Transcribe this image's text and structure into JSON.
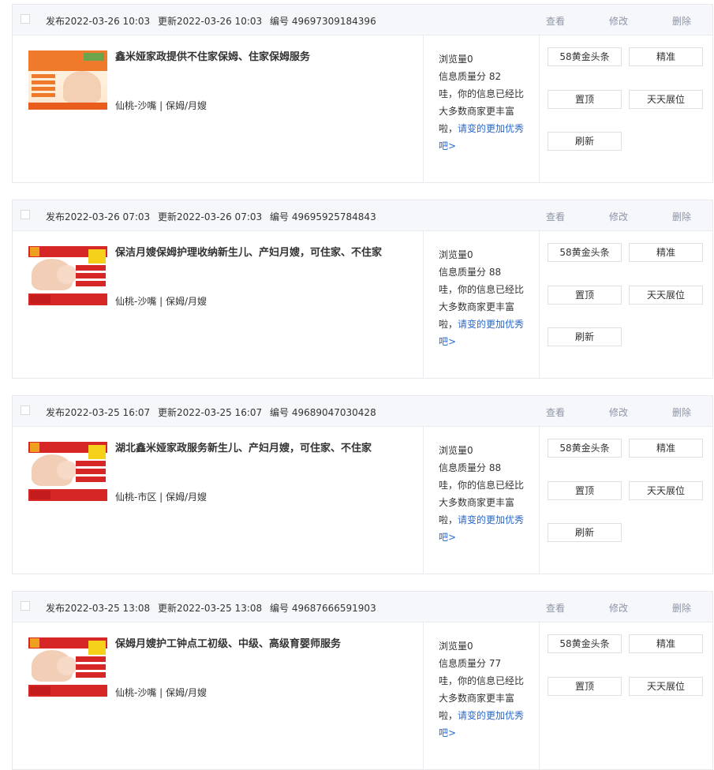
{
  "labels": {
    "view": "查看",
    "edit": "修改",
    "delete": "删除",
    "btn_headline": "58黄金头条",
    "btn_precise": "精准",
    "btn_top": "置顶",
    "btn_daily": "天天展位",
    "btn_refresh": "刷新",
    "views_prefix": "浏览量",
    "quality_prefix": "信息质量分 ",
    "tip_text": "哇，你的信息已经比大多数商家更丰富啦，",
    "tip_link": "请变的更加优秀吧>"
  },
  "listings": [
    {
      "published": "发布2022-03-26   10:03",
      "updated": "更新2022-03-26   10:03",
      "id": "编号   49697309184396",
      "title": "鑫米娅家政提供不住家保姆、住家保姆服务",
      "location": "仙桃-沙嘴 | 保姆/月嫂",
      "views": "0",
      "quality": "82"
    },
    {
      "published": "发布2022-03-26   07:03",
      "updated": "更新2022-03-26   07:03",
      "id": "编号   49695925784843",
      "title": "保洁月嫂保姆护理收纳新生儿、产妇月嫂，可住家、不住家",
      "location": "仙桃-沙嘴 | 保姆/月嫂",
      "views": "0",
      "quality": "88"
    },
    {
      "published": "发布2022-03-25   16:07",
      "updated": "更新2022-03-25   16:07",
      "id": "编号   49689047030428",
      "title": "湖北鑫米娅家政服务新生儿、产妇月嫂，可住家、不住家",
      "location": "仙桃-市区 | 保姆/月嫂",
      "views": "0",
      "quality": "88"
    },
    {
      "published": "发布2022-03-25   13:08",
      "updated": "更新2022-03-25   13:08",
      "id": "编号   49687666591903",
      "title": "保姆月嫂护工钟点工初级、中级、高级育婴师服务",
      "location": "仙桃-沙嘴 | 保姆/月嫂",
      "views": "0",
      "quality": "77"
    }
  ]
}
